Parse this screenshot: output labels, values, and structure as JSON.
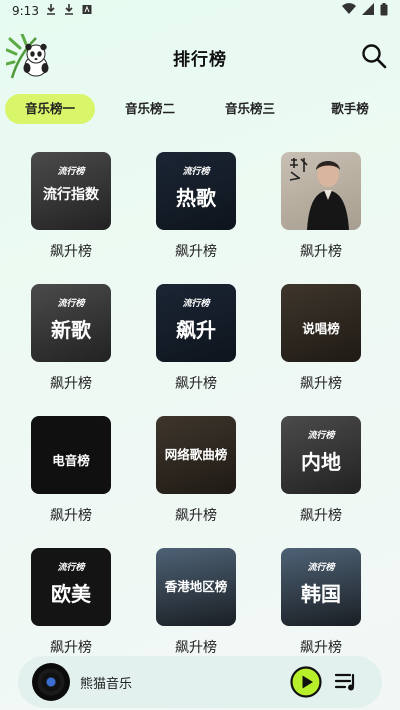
{
  "status": {
    "time": "9:13",
    "left_icons": [
      "download-icon",
      "download-icon",
      "font-icon"
    ],
    "right_icons": [
      "wifi-icon",
      "signal-icon",
      "battery-icon"
    ]
  },
  "header": {
    "title": "排行榜",
    "logo_icon": "panda-bamboo-logo",
    "search_icon": "search-icon"
  },
  "tabs": [
    {
      "label": "音乐榜一",
      "active": true
    },
    {
      "label": "音乐榜二",
      "active": false
    },
    {
      "label": "音乐榜三",
      "active": false
    },
    {
      "label": "歌手榜",
      "active": false
    }
  ],
  "cards": [
    {
      "badge": "流行榜",
      "title": "流行指数",
      "sub": "",
      "label": "飙升榜"
    },
    {
      "badge": "流行榜",
      "title": "热歌",
      "sub": "",
      "label": "飙升榜"
    },
    {
      "badge": "",
      "title": "",
      "sub": "",
      "label": "飙升榜"
    },
    {
      "badge": "流行榜",
      "title": "新歌",
      "sub": "",
      "label": "飙升榜"
    },
    {
      "badge": "流行榜",
      "title": "飙升",
      "sub": "",
      "label": "飙升榜"
    },
    {
      "badge": "",
      "title": "说唱榜",
      "sub": "",
      "label": "飙升榜"
    },
    {
      "badge": "",
      "title": "电音榜",
      "sub": "",
      "label": "飙升榜"
    },
    {
      "badge": "",
      "title": "网络歌曲榜",
      "sub": "",
      "label": "飙升榜"
    },
    {
      "badge": "流行榜",
      "title": "内地",
      "sub": "",
      "label": "飙升榜"
    },
    {
      "badge": "流行榜",
      "title": "欧美",
      "sub": "",
      "label": "飙升榜"
    },
    {
      "badge": "",
      "title": "香港地区榜",
      "sub": "",
      "label": "飙升榜"
    },
    {
      "badge": "流行榜",
      "title": "韩国",
      "sub": "",
      "label": "飙升榜"
    }
  ],
  "player": {
    "title": "熊猫音乐",
    "play_icon": "play-icon",
    "list_icon": "playlist-icon"
  },
  "colors": {
    "accent": "#d9f56a",
    "background": "#e8f9f1",
    "play_ring": "#b7ef2a"
  }
}
